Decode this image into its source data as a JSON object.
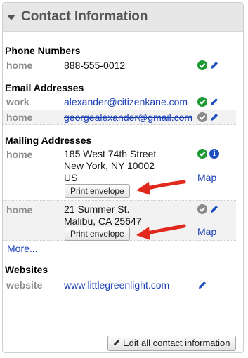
{
  "panel": {
    "title": "Contact Information"
  },
  "phone": {
    "title": "Phone Numbers",
    "items": [
      {
        "label": "home",
        "value": "888-555-0012"
      }
    ]
  },
  "email": {
    "title": "Email Addresses",
    "items": [
      {
        "label": "work",
        "value": "alexander@citizenkane.com"
      },
      {
        "label": "home",
        "value": "georgealexander@gmail.com"
      }
    ]
  },
  "mailing": {
    "title": "Mailing Addresses",
    "items": [
      {
        "label": "home",
        "lines": [
          "185 West 74th Street",
          "New York, NY 10002",
          "US"
        ],
        "map": "Map",
        "print": "Print envelope"
      },
      {
        "label": "home",
        "lines": [
          "21 Summer St.",
          "Malibu, CA 25647"
        ],
        "map": "Map",
        "print": "Print envelope"
      }
    ],
    "more": "More..."
  },
  "websites": {
    "title": "Websites",
    "items": [
      {
        "label": "website",
        "value": "www.littlegreenlight.com"
      }
    ]
  },
  "footer": {
    "edit_all": "Edit all contact information"
  },
  "colors": {
    "link": "#1a3fb5",
    "ok": "#1e9a35",
    "info": "#1d4fc0",
    "arrow": "#e0281d"
  }
}
